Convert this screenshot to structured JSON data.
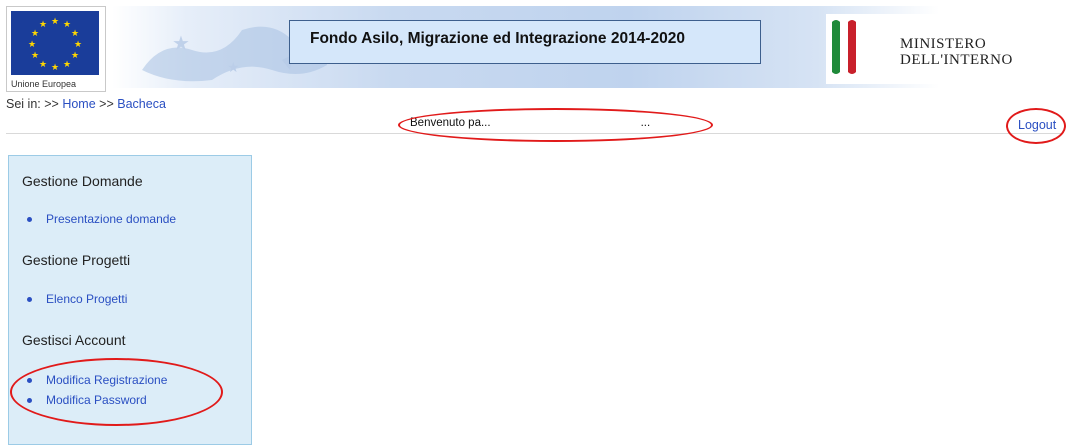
{
  "header": {
    "eu_label": "Unione Europea",
    "title": "Fondo Asilo, Migrazione ed Integrazione 2014-2020",
    "ministry_line1": "MINISTERO",
    "ministry_line2": "DELL'INTERNO"
  },
  "breadcrumb": {
    "prefix": "Sei in:",
    "sep1": ">>",
    "home": "Home",
    "sep2": ">>",
    "current": "Bacheca"
  },
  "welcome": {
    "text": "Benvenuto pa...",
    "trail": "..."
  },
  "logout_label": "Logout",
  "sidebar": {
    "sections": [
      {
        "title": "Gestione Domande",
        "items": [
          {
            "label": "Presentazione domande"
          }
        ]
      },
      {
        "title": "Gestione Progetti",
        "items": [
          {
            "label": "Elenco Progetti"
          }
        ]
      },
      {
        "title": "Gestisci Account",
        "items": [
          {
            "label": "Modifica Registrazione"
          },
          {
            "label": "Modifica Password"
          }
        ]
      }
    ]
  },
  "colors": {
    "link": "#2a4fc2",
    "sidebar_bg": "#dcedf8",
    "annotation": "#e11a1a",
    "title_box": "#d5e7fa"
  }
}
